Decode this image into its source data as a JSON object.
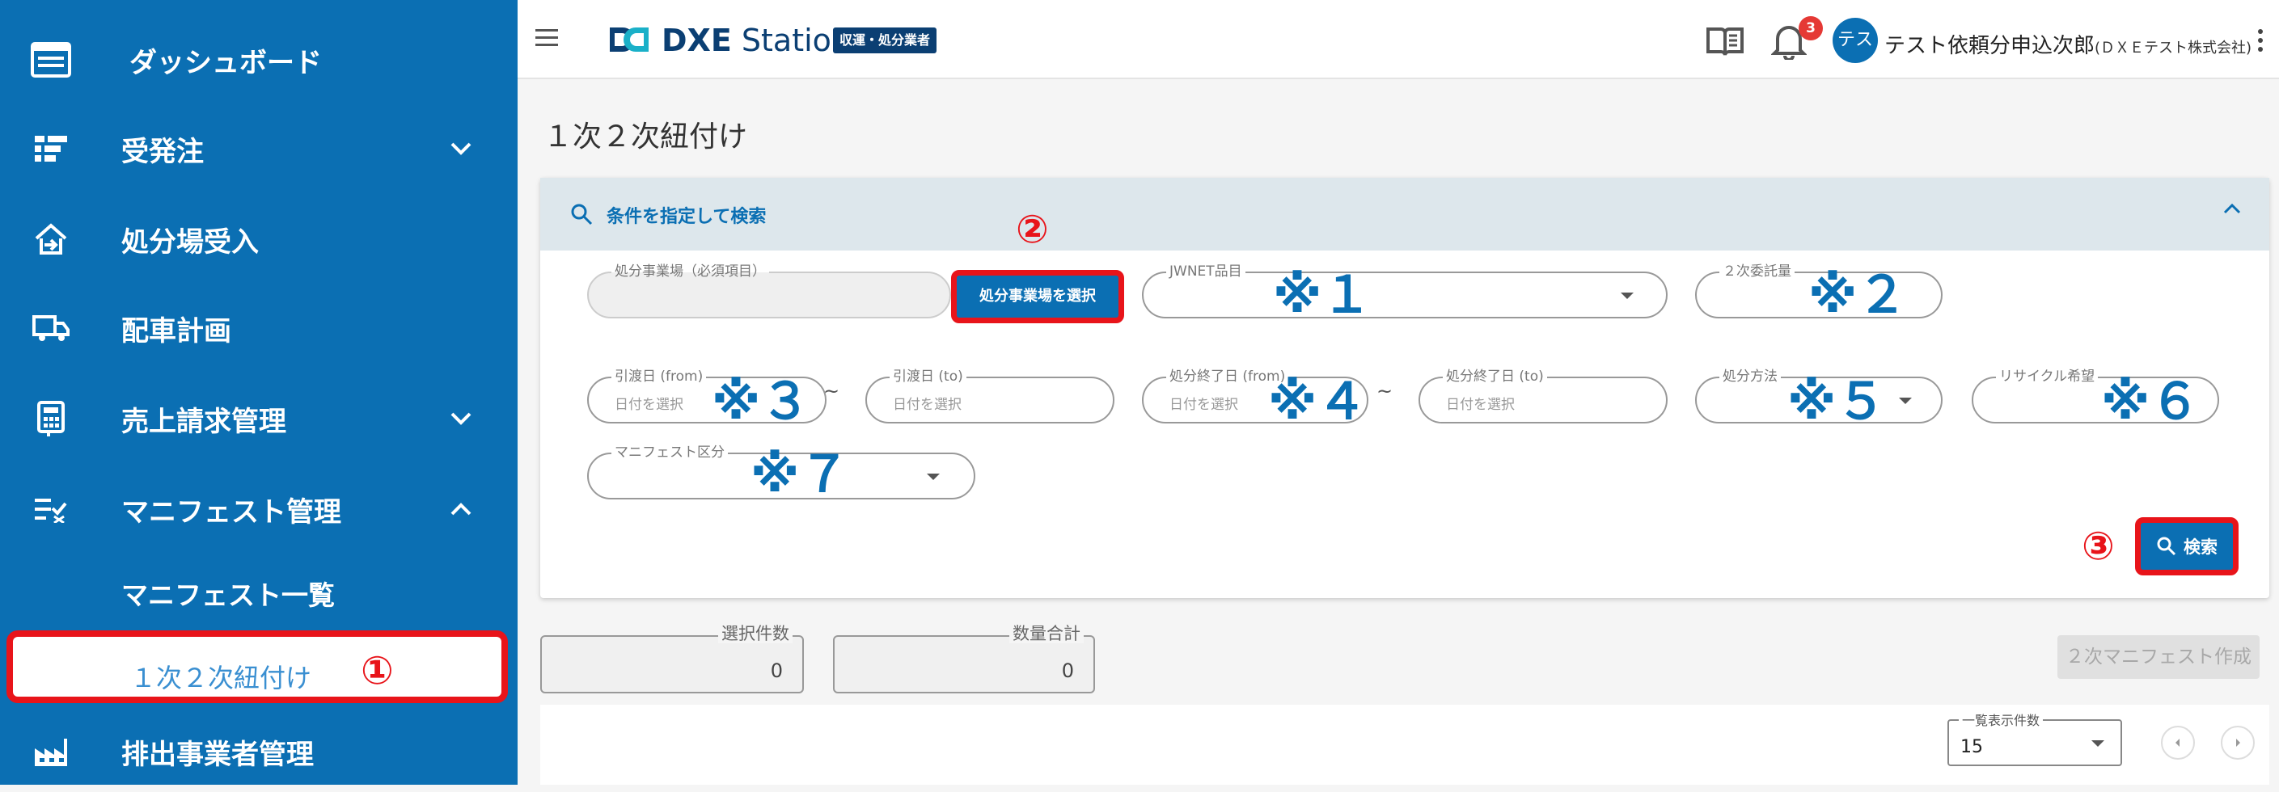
{
  "sidebar": {
    "items": [
      {
        "label": "ダッシュボード"
      },
      {
        "label": "受発注"
      },
      {
        "label": "処分場受入"
      },
      {
        "label": "配車計画"
      },
      {
        "label": "売上請求管理"
      },
      {
        "label": "マニフェスト管理"
      },
      {
        "label": "マニフェスト一覧"
      },
      {
        "label": "１次２次紐付け"
      },
      {
        "label": "排出事業者管理"
      }
    ],
    "callout": "①"
  },
  "header": {
    "logo_bold": "DXE",
    "logo_rest": "Station",
    "badge": "収運・処分業者",
    "notifications": "3",
    "avatar": "テス",
    "user_name": "テスト依頼分申込次郎",
    "user_company": "(ＤＸＥテスト株式会社)"
  },
  "page": {
    "title": "１次２次紐付け"
  },
  "search_panel": {
    "title": "条件を指定して検索",
    "site_field": {
      "label": "処分事業場（必須項目）"
    },
    "site_button": {
      "label": "処分事業場を選択",
      "callout": "②"
    },
    "jwnet": {
      "label": "JWNET品目",
      "mark": "※１"
    },
    "second_commission": {
      "label": "２次委託量",
      "mark": "※２"
    },
    "transfer_from": {
      "label": "引渡日 (from)",
      "placeholder": "日付を選択",
      "mark": "※３"
    },
    "transfer_to": {
      "label": "引渡日 (to)",
      "placeholder": "日付を選択"
    },
    "disposal_from": {
      "label": "処分終了日 (from)",
      "placeholder": "日付を選択",
      "mark": "※４"
    },
    "disposal_to": {
      "label": "処分終了日 (to)",
      "placeholder": "日付を選択"
    },
    "disposal_method": {
      "label": "処分方法",
      "mark": "※５"
    },
    "recycle": {
      "label": "リサイクル希望",
      "mark": "※６"
    },
    "manifest_type": {
      "label": "マニフェスト区分",
      "mark": "※７"
    },
    "tilde": "~",
    "search_button": {
      "label": "検索",
      "callout": "③"
    }
  },
  "summary": {
    "selected_label": "選択件数",
    "selected_value": "0",
    "quantity_label": "数量合計",
    "quantity_value": "0",
    "create_button": "２次マニフェスト作成"
  },
  "list": {
    "per_page_label": "一覧表示件数",
    "per_page_value": "15"
  },
  "colors": {
    "sidebar": "#0b6fb3",
    "accent": "#0b6fb3",
    "highlight": "#e8141a"
  }
}
